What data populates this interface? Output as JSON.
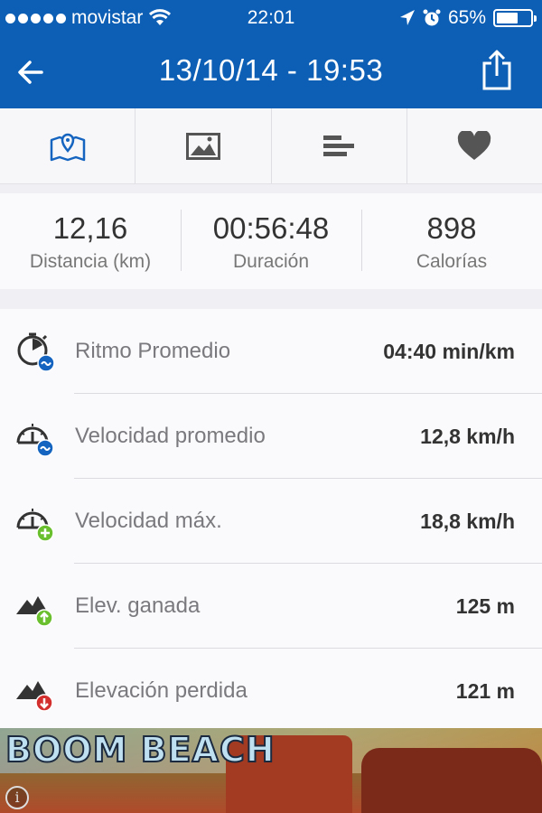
{
  "status_bar": {
    "carrier": "movistar",
    "time": "22:01",
    "battery": "65%",
    "battery_level": 0.65,
    "icons": [
      "signal-dots-icon",
      "wifi-icon",
      "location-arrow-icon",
      "alarm-clock-icon",
      "battery-icon"
    ]
  },
  "nav": {
    "title": "13/10/14 - 19:53",
    "back_icon": "back-arrow-icon",
    "share_icon": "share-icon"
  },
  "tabs": [
    {
      "icon": "map-pin-icon",
      "active": true
    },
    {
      "icon": "image-icon",
      "active": false
    },
    {
      "icon": "bars-icon",
      "active": false
    },
    {
      "icon": "heart-icon",
      "active": false
    }
  ],
  "summary": [
    {
      "value": "12,16",
      "label": "Distancia (km)"
    },
    {
      "value": "00:56:48",
      "label": "Duración"
    },
    {
      "value": "898",
      "label": "Calorías"
    }
  ],
  "stats": [
    {
      "icon": "stopwatch-avg-icon",
      "label": "Ritmo Promedio",
      "value": "04:40 min/km"
    },
    {
      "icon": "speedometer-avg-icon",
      "label": "Velocidad promedio",
      "value": "12,8 km/h"
    },
    {
      "icon": "speedometer-max-icon",
      "label": "Velocidad máx.",
      "value": "18,8 km/h"
    },
    {
      "icon": "elevation-gain-icon",
      "label": "Elev. ganada",
      "value": "125 m"
    },
    {
      "icon": "elevation-loss-icon",
      "label": "Elevación perdida",
      "value": "121 m"
    }
  ],
  "ad": {
    "brand": "BOOM BEACH",
    "info_glyph": "i"
  },
  "colors": {
    "header_blue": "#0d5fb5",
    "active_icon_blue": "#1565c0",
    "badge_green": "#6abf2e",
    "badge_red": "#d32f2f",
    "badge_blue": "#1565c0"
  }
}
